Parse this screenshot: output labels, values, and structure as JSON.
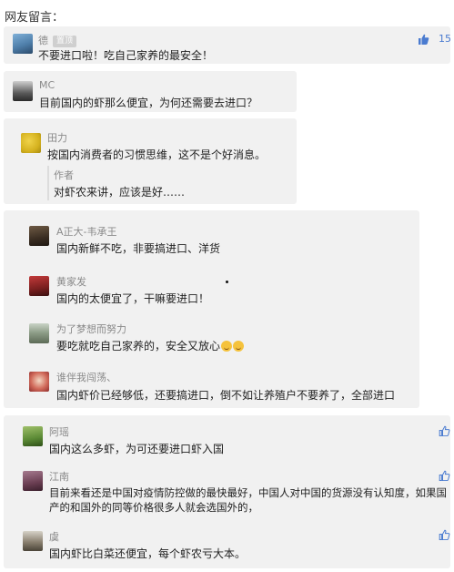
{
  "header": {
    "title": "网友留言："
  },
  "comments": [
    {
      "name": "德",
      "badge": "置顶",
      "text": "不要进口啦！吃自己家养的最安全！",
      "likes": "15"
    },
    {
      "name": "MC",
      "text": "目前国内的虾那么便宜，为何还需要去进口？"
    },
    {
      "name": "田力",
      "text": "按国内消费者的习惯思维，这不是个好消息。",
      "reply": {
        "name": "作者",
        "text": "对虾农来讲，应该是好……"
      }
    },
    {
      "group": [
        {
          "name": "A正大-韦承王",
          "text": "国内新鲜不吃，非要搞进口、洋货"
        },
        {
          "name": "黄家发",
          "text": "国内的太便宜了，干嘛要进口！"
        },
        {
          "name": "为了梦想而努力",
          "text": "要吃就吃自己家养的，安全又放心"
        },
        {
          "name": "谁伴我闯荡、",
          "text": "国内虾价已经够低，还要搞进口，倒不如让养殖户不要养了，全部进口"
        }
      ]
    },
    {
      "group2": [
        {
          "name": "阿瑶",
          "text": "国内这么多虾，为可还要进口虾入国"
        },
        {
          "name": "江南",
          "text": "目前来看还是中国对疫情防控做的最快最好，中国人对中国的货源没有认知度，如果国",
          "text2": "产的和国外的同等价格很多人就会选国外的，"
        },
        {
          "name": "虞",
          "text": "国内虾比白菜还便宜，每个虾农亏大本。"
        }
      ]
    }
  ]
}
